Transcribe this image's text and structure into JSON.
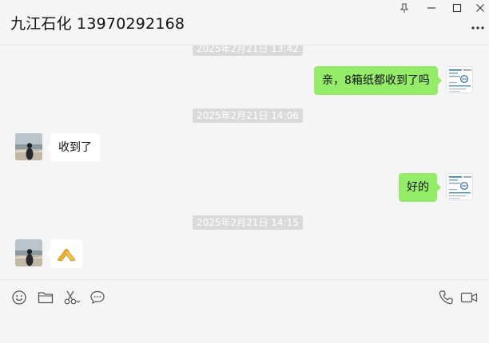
{
  "header": {
    "title": "九江石化 13970292168"
  },
  "window_controls": {
    "pin_icon": "pin-icon",
    "minimize_icon": "minimize-icon",
    "maximize_icon": "maximize-icon",
    "close_icon": "close-icon",
    "more_icon": "more-icon"
  },
  "messages": [
    {
      "type": "timestamp",
      "text": "2025年2月21日 13:42"
    },
    {
      "type": "message",
      "sender": "me",
      "text": "亲，8箱纸都收到了吗"
    },
    {
      "type": "timestamp",
      "text": "2025年2月21日 14:06"
    },
    {
      "type": "message",
      "sender": "them",
      "text": "收到了"
    },
    {
      "type": "message",
      "sender": "me",
      "text": "好的"
    },
    {
      "type": "timestamp",
      "text": "2025年2月21日 14:15"
    },
    {
      "type": "message",
      "sender": "them",
      "sticker": "fist-bump-emoji"
    }
  ],
  "toolbar": {
    "left_icons": [
      "emoji-icon",
      "folder-icon",
      "scissors-icon",
      "chat-bubble-icon"
    ],
    "right_icons": [
      "phone-icon",
      "video-call-icon"
    ]
  },
  "colors": {
    "my_bubble": "#95ec69",
    "their_bubble": "#ffffff",
    "background": "#f5f5f5",
    "timestamp_bg": "#dadada"
  }
}
